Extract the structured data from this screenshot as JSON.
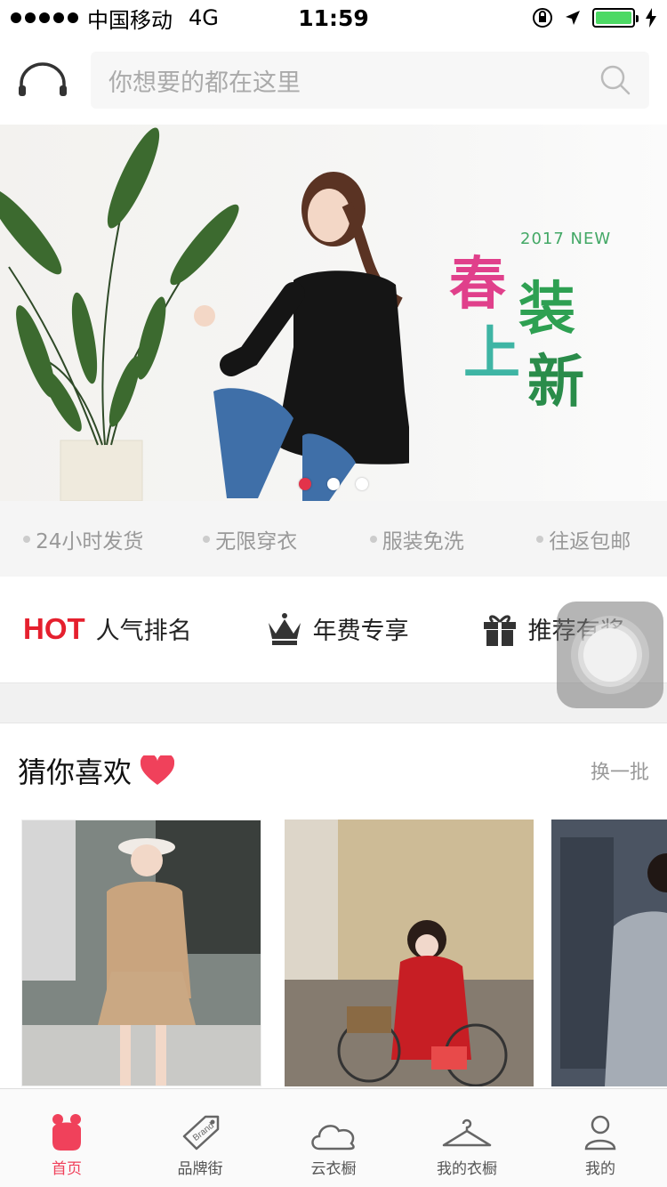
{
  "status_bar": {
    "carrier": "中国移动",
    "network": "4G",
    "time": "11:59"
  },
  "header": {
    "headset_icon": "headset-icon",
    "search_placeholder": "你想要的都在这里",
    "search_icon": "search-icon"
  },
  "banner": {
    "promo_tag": "2017 NEW",
    "promo_chars": [
      "春",
      "装",
      "上",
      "新"
    ],
    "page_count": 3,
    "active_page": 1
  },
  "features": [
    "24小时发货",
    "无限穿衣",
    "服装免洗",
    "往返包邮"
  ],
  "quick_links": {
    "hot_badge": "HOT",
    "hot_label": "人气排名",
    "vip_label": "年费专享",
    "reward_label": "推荐有奖"
  },
  "guess": {
    "title": "猜你喜欢",
    "refresh": "换一批"
  },
  "tabs": [
    {
      "label": "首页",
      "icon": "home-bear-icon",
      "active": true
    },
    {
      "label": "品牌街",
      "icon": "brand-tag-icon",
      "active": false
    },
    {
      "label": "云衣橱",
      "icon": "cloud-icon",
      "active": false
    },
    {
      "label": "我的衣橱",
      "icon": "hanger-icon",
      "active": false
    },
    {
      "label": "我的",
      "icon": "user-icon",
      "active": false
    }
  ],
  "colors": {
    "accent": "#f0415b",
    "hot": "#e5202e",
    "muted": "#999999"
  }
}
